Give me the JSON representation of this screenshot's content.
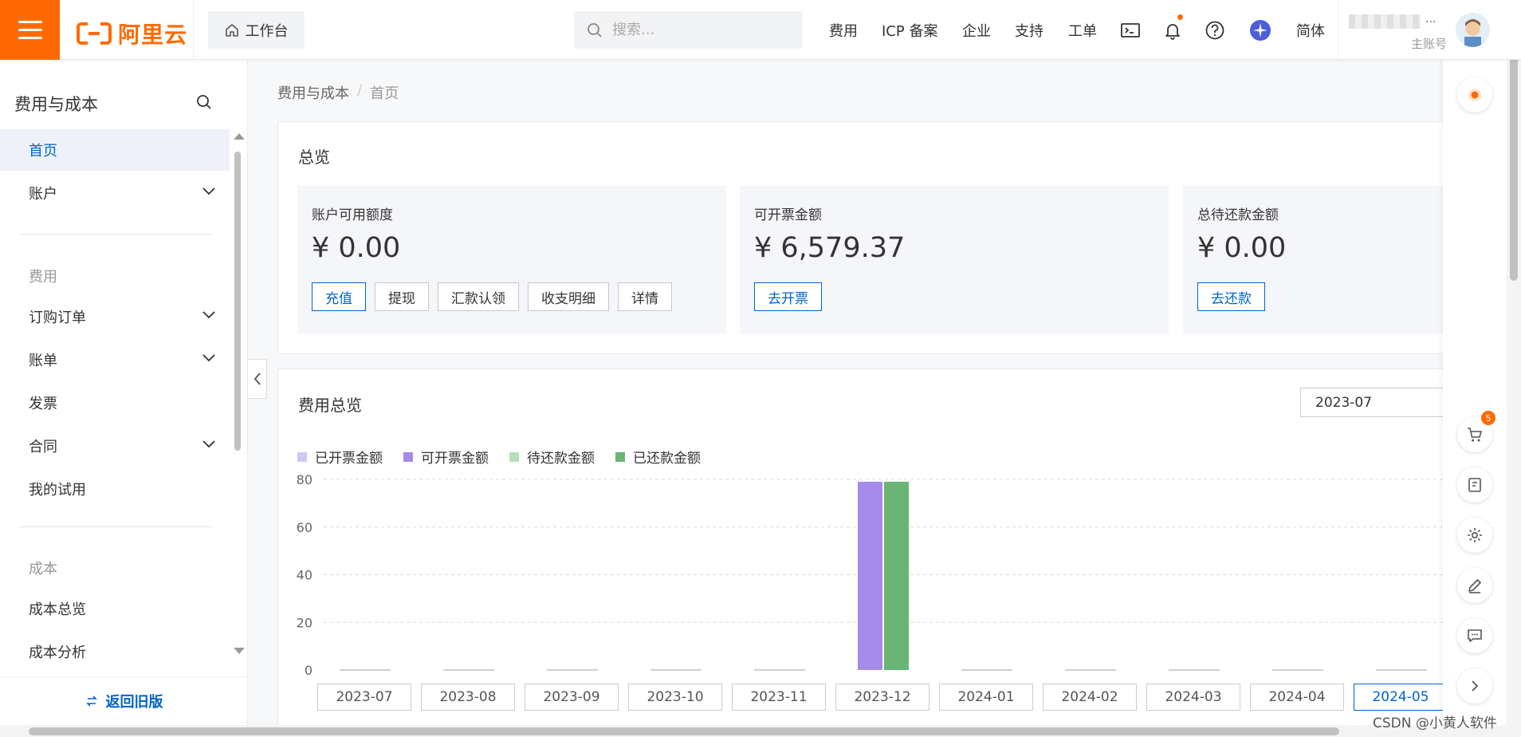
{
  "topbar": {
    "logo_text": "阿里云",
    "workbench_label": "工作台",
    "search_placeholder": "搜索...",
    "nav": [
      "费用",
      "ICP 备案",
      "企业",
      "支持",
      "工单"
    ],
    "lang_label": "简体",
    "account_dots": "...",
    "account_sub": "主账号",
    "accent_color": "#ff6a00"
  },
  "sidebar": {
    "title": "费用与成本",
    "items": {
      "home": "首页",
      "account": "账户",
      "group_fee": "费用",
      "orders": "订购订单",
      "bills": "账单",
      "invoice": "发票",
      "contract": "合同",
      "trial": "我的试用",
      "group_cost": "成本",
      "cost_overview": "成本总览",
      "cost_analysis": "成本分析"
    },
    "footer_label": "返回旧版"
  },
  "breadcrumb": {
    "root": "费用与成本",
    "sep": "/",
    "current": "首页"
  },
  "overview": {
    "title": "总览",
    "cards": [
      {
        "label": "账户可用额度",
        "amount": "¥ 0.00",
        "buttons": [
          "充值",
          "提现",
          "汇款认领",
          "收支明细",
          "详情"
        ]
      },
      {
        "label": "可开票金额",
        "amount": "¥ 6,579.37",
        "buttons": [
          "去开票"
        ]
      },
      {
        "label": "总待还款金额",
        "amount": "¥ 0.00",
        "buttons": [
          "去还款"
        ]
      }
    ]
  },
  "fee_overview": {
    "title": "费用总览",
    "date_value": "2023-07"
  },
  "chart_data": {
    "type": "bar",
    "categories": [
      "2023-07",
      "2023-08",
      "2023-09",
      "2023-10",
      "2023-11",
      "2023-12",
      "2024-01",
      "2024-02",
      "2024-03",
      "2024-04",
      "2024-05"
    ],
    "selected_category": "2024-05",
    "series": [
      {
        "name": "已开票金额",
        "color": "#d3c6f5",
        "values": [
          0,
          0,
          0,
          0,
          0,
          0,
          0,
          0,
          0,
          0,
          0
        ]
      },
      {
        "name": "可开票金额",
        "color": "#a78bea",
        "values": [
          0,
          0,
          0,
          0,
          0,
          79,
          0,
          0,
          0,
          0,
          0
        ]
      },
      {
        "name": "待还款金额",
        "color": "#b7e0b9",
        "values": [
          0,
          0,
          0,
          0,
          0,
          0,
          0,
          0,
          0,
          0,
          0
        ]
      },
      {
        "name": "已还款金额",
        "color": "#6bb574",
        "values": [
          0,
          0,
          0,
          0,
          0,
          79,
          0,
          0,
          0,
          0,
          0
        ]
      }
    ],
    "yticks": [
      0,
      20,
      40,
      60,
      80
    ],
    "ylim": [
      0,
      80
    ],
    "grid": true,
    "legend": "top-left"
  },
  "right_panel": {
    "cart_badge": "5"
  },
  "watermark": "CSDN @小黄人软件"
}
